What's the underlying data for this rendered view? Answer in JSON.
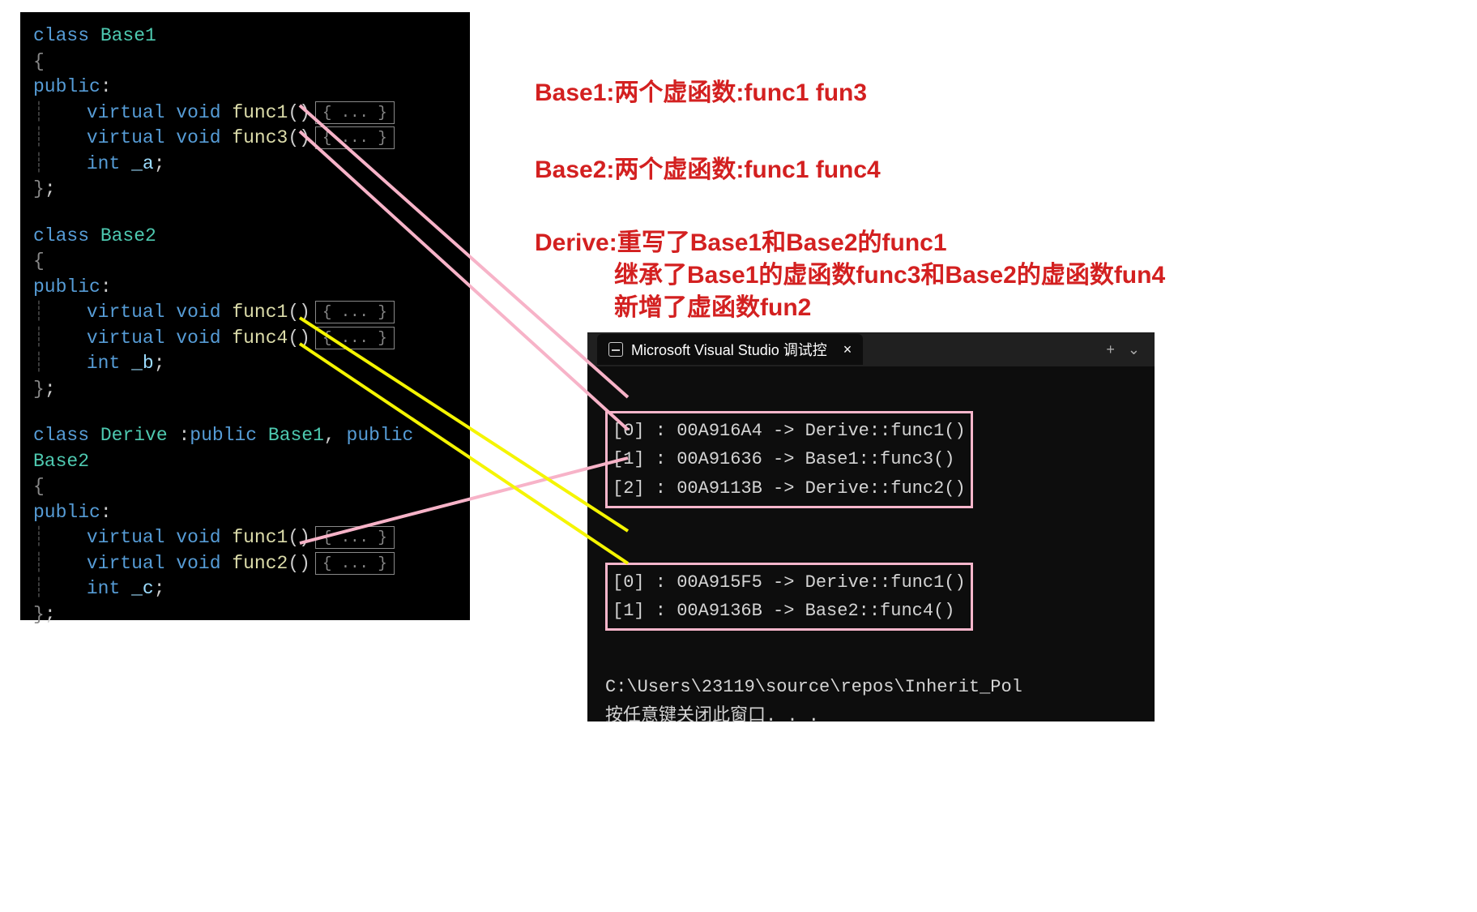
{
  "code": {
    "base1": {
      "decl": "class Base1",
      "open_brace": "{",
      "public": "public:",
      "func1": {
        "virtual": "virtual",
        "void": "void",
        "name": "func1",
        "parens": "()",
        "body": "{ ... }"
      },
      "func3": {
        "virtual": "virtual",
        "void": "void",
        "name": "func3",
        "parens": "()",
        "body": "{ ... }"
      },
      "member": {
        "int": "int",
        "name": "_a",
        "semi": ";"
      },
      "close": "};"
    },
    "base2": {
      "decl": "class Base2",
      "open_brace": "{",
      "public": "public:",
      "func1": {
        "virtual": "virtual",
        "void": "void",
        "name": "func1",
        "parens": "()",
        "body": "{ ... }"
      },
      "func4": {
        "virtual": "virtual",
        "void": "void",
        "name": "func4",
        "parens": "()",
        "body": "{ ... }"
      },
      "member": {
        "int": "int",
        "name": "_b",
        "semi": ";"
      },
      "close": "};"
    },
    "derive": {
      "decl": {
        "class": "class",
        "name": "Derive",
        "colon": " :",
        "pub1": "public",
        "b1": " Base1",
        "comma": ", ",
        "pub2": "public",
        "b2": " Base2"
      },
      "open_brace": "{",
      "public": "public:",
      "func1": {
        "virtual": "virtual",
        "void": "void",
        "name": "func1",
        "parens": "()",
        "body": "{ ... }"
      },
      "func2": {
        "virtual": "virtual",
        "void": "void",
        "name": "func2",
        "parens": "()",
        "body": "{ ... }"
      },
      "member": {
        "int": "int",
        "name": "_c",
        "semi": ";"
      },
      "close": "};"
    }
  },
  "annotations": {
    "line1": "Base1:两个虚函数:func1 fun3",
    "line2": "Base2:两个虚函数:func1 func4",
    "line3": "Derive:重写了Base1和Base2的func1",
    "line4": "继承了Base1的虚函数func3和Base2的虚函数fun4",
    "line5": "新增了虚函数fun2"
  },
  "console": {
    "title": "Microsoft Visual Studio 调试控",
    "close_glyph": "×",
    "plus_glyph": "+",
    "chevron_glyph": "⌄",
    "vtable1": [
      "[0] : 00A916A4 -> Derive::func1()",
      "[1] : 00A91636 -> Base1::func3()",
      "[2] : 00A9113B -> Derive::func2()"
    ],
    "vtable2": [
      "[0] : 00A915F5 -> Derive::func1()",
      "[1] : 00A9136B -> Base2::func4()"
    ],
    "footer_path": "C:\\Users\\23119\\source\\repos\\Inherit_Pol",
    "footer_prompt": "按任意键关闭此窗口. . ."
  },
  "colors": {
    "pink": "#f7b3c8",
    "yellow": "#f5f500",
    "red": "#d32020"
  }
}
